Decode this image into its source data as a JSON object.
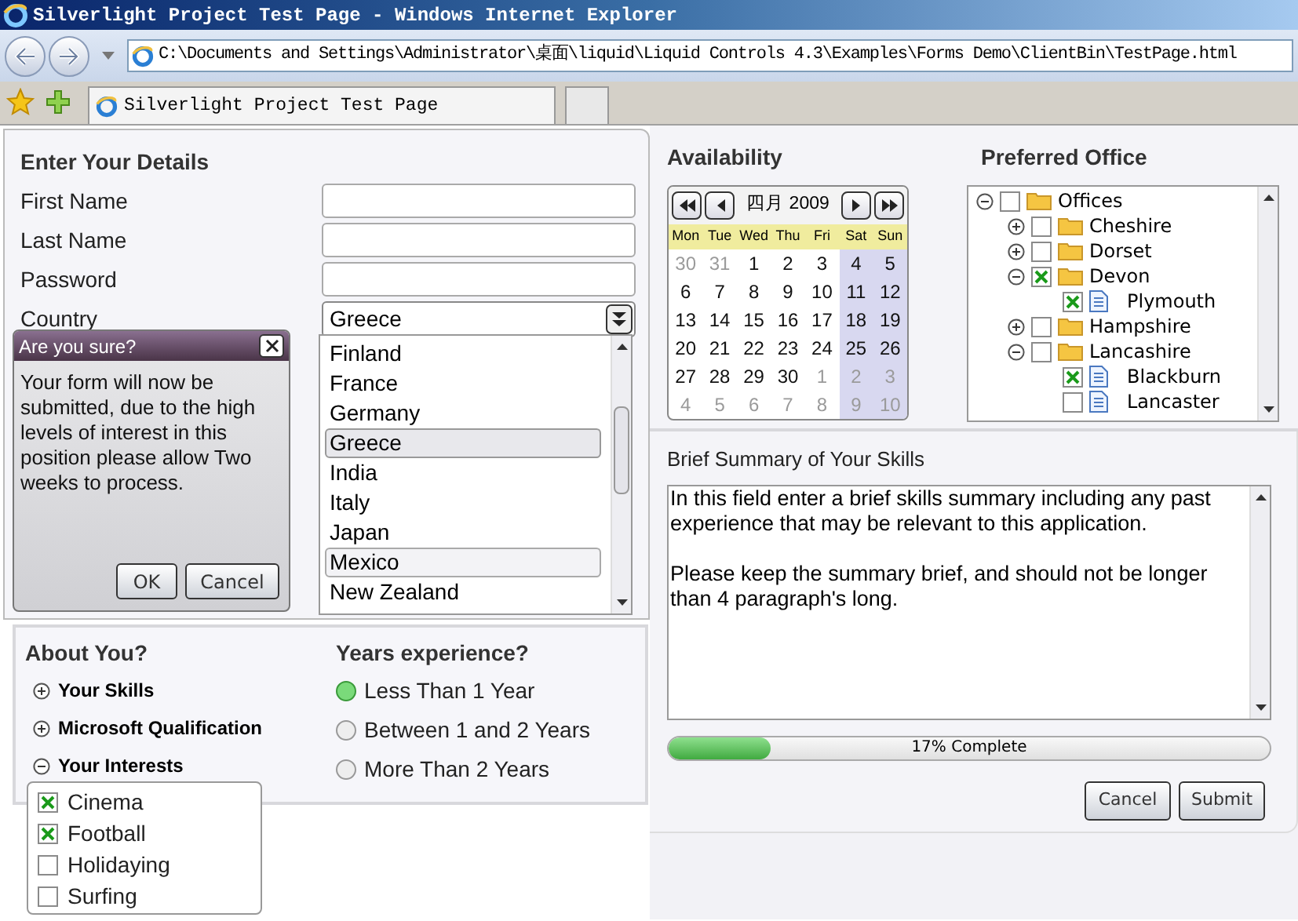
{
  "browser": {
    "title": "Silverlight Project Test Page - Windows Internet Explorer",
    "address": "C:\\Documents and Settings\\Administrator\\桌面\\liquid\\Liquid Controls 4.3\\Examples\\Forms Demo\\ClientBin\\TestPage.html",
    "tab_title": "Silverlight Project Test Page"
  },
  "details": {
    "heading": "Enter Your Details",
    "fields": [
      {
        "label": "First Name"
      },
      {
        "label": "Last Name"
      },
      {
        "label": "Password"
      }
    ],
    "country": {
      "label": "Country",
      "value": "Greece",
      "options": [
        {
          "label": "Finland",
          "selected": false,
          "hovered": false
        },
        {
          "label": "France",
          "selected": false,
          "hovered": false
        },
        {
          "label": "Germany",
          "selected": false,
          "hovered": false
        },
        {
          "label": "Greece",
          "selected": true,
          "hovered": false
        },
        {
          "label": "India",
          "selected": false,
          "hovered": false
        },
        {
          "label": "Italy",
          "selected": false,
          "hovered": false
        },
        {
          "label": "Japan",
          "selected": false,
          "hovered": false
        },
        {
          "label": "Mexico",
          "selected": false,
          "hovered": true
        },
        {
          "label": "New Zealand",
          "selected": false,
          "hovered": false
        }
      ]
    }
  },
  "dialog": {
    "title": "Are you sure?",
    "message": "Your form will now be submitted, due to the high levels of interest in this position please allow Two weeks to process.",
    "buttons": [
      "OK",
      "Cancel"
    ]
  },
  "about": {
    "heading": "About You?",
    "sections": [
      {
        "label": "Your Skills",
        "expanded": false
      },
      {
        "label": "Microsoft Qualification",
        "expanded": false
      },
      {
        "label": "Your Interests",
        "expanded": true
      }
    ],
    "interests": [
      {
        "label": "Cinema",
        "checked": true
      },
      {
        "label": "Football",
        "checked": true
      },
      {
        "label": "Holidaying",
        "checked": false
      },
      {
        "label": "Surfing",
        "checked": false
      }
    ]
  },
  "experience": {
    "heading": "Years experience?",
    "options": [
      {
        "label": "Less Than 1 Year",
        "selected": true
      },
      {
        "label": "Between 1 and 2 Years",
        "selected": false
      },
      {
        "label": "More Than 2 Years",
        "selected": false
      }
    ]
  },
  "availability": {
    "heading": "Availability",
    "month": "四月 2009",
    "weekdays": [
      "Mon",
      "Tue",
      "Wed",
      "Thu",
      "Fri",
      "Sat",
      "Sun"
    ],
    "weeks": [
      [
        {
          "day": "30",
          "other_month": true
        },
        {
          "day": "31",
          "other_month": true
        },
        {
          "day": "1",
          "other_month": false
        },
        {
          "day": "2",
          "other_month": false
        },
        {
          "day": "3",
          "other_month": false
        },
        {
          "day": "4",
          "other_month": false
        },
        {
          "day": "5",
          "other_month": false
        }
      ],
      [
        {
          "day": "6",
          "other_month": false
        },
        {
          "day": "7",
          "other_month": false
        },
        {
          "day": "8",
          "other_month": false
        },
        {
          "day": "9",
          "other_month": false
        },
        {
          "day": "10",
          "other_month": false
        },
        {
          "day": "11",
          "other_month": false
        },
        {
          "day": "12",
          "other_month": false
        }
      ],
      [
        {
          "day": "13",
          "other_month": false
        },
        {
          "day": "14",
          "other_month": false
        },
        {
          "day": "15",
          "other_month": false
        },
        {
          "day": "16",
          "other_month": false
        },
        {
          "day": "17",
          "other_month": false
        },
        {
          "day": "18",
          "other_month": false
        },
        {
          "day": "19",
          "other_month": false
        }
      ],
      [
        {
          "day": "20",
          "other_month": false
        },
        {
          "day": "21",
          "other_month": false
        },
        {
          "day": "22",
          "other_month": false
        },
        {
          "day": "23",
          "other_month": false
        },
        {
          "day": "24",
          "other_month": false
        },
        {
          "day": "25",
          "other_month": false
        },
        {
          "day": "26",
          "other_month": false
        }
      ],
      [
        {
          "day": "27",
          "other_month": false
        },
        {
          "day": "28",
          "other_month": false
        },
        {
          "day": "29",
          "other_month": false
        },
        {
          "day": "30",
          "other_month": false
        },
        {
          "day": "1",
          "other_month": true
        },
        {
          "day": "2",
          "other_month": true
        },
        {
          "day": "3",
          "other_month": true
        }
      ],
      [
        {
          "day": "4",
          "other_month": true
        },
        {
          "day": "5",
          "other_month": true
        },
        {
          "day": "6",
          "other_month": true
        },
        {
          "day": "7",
          "other_month": true
        },
        {
          "day": "8",
          "other_month": true
        },
        {
          "day": "9",
          "other_month": true
        },
        {
          "day": "10",
          "other_month": true
        }
      ]
    ]
  },
  "office": {
    "heading": "Preferred Office",
    "tree": [
      {
        "label": "Offices",
        "kind": "folder",
        "expanded": true,
        "checked": false,
        "children": [
          {
            "label": "Cheshire",
            "kind": "folder",
            "expanded": false,
            "checked": false
          },
          {
            "label": "Dorset",
            "kind": "folder",
            "expanded": false,
            "checked": false
          },
          {
            "label": "Devon",
            "kind": "folder",
            "expanded": true,
            "checked": true,
            "children": [
              {
                "label": "Plymouth",
                "kind": "file",
                "checked": true
              }
            ]
          },
          {
            "label": "Hampshire",
            "kind": "folder",
            "expanded": false,
            "checked": false
          },
          {
            "label": "Lancashire",
            "kind": "folder",
            "expanded": true,
            "checked": false,
            "children": [
              {
                "label": "Blackburn",
                "kind": "file",
                "checked": true
              },
              {
                "label": "Lancaster",
                "kind": "file",
                "checked": false
              }
            ]
          }
        ]
      }
    ]
  },
  "summary": {
    "label": "Brief Summary of Your Skills",
    "value": "In this field enter a brief skills summary including any past experience that may be relevant to this application.\n\nPlease keep the summary brief, and should not be longer than 4 paragraph's long."
  },
  "progress": {
    "level": 0.17,
    "label": "17% Complete"
  },
  "buttons": [
    "Cancel",
    "Submit"
  ]
}
